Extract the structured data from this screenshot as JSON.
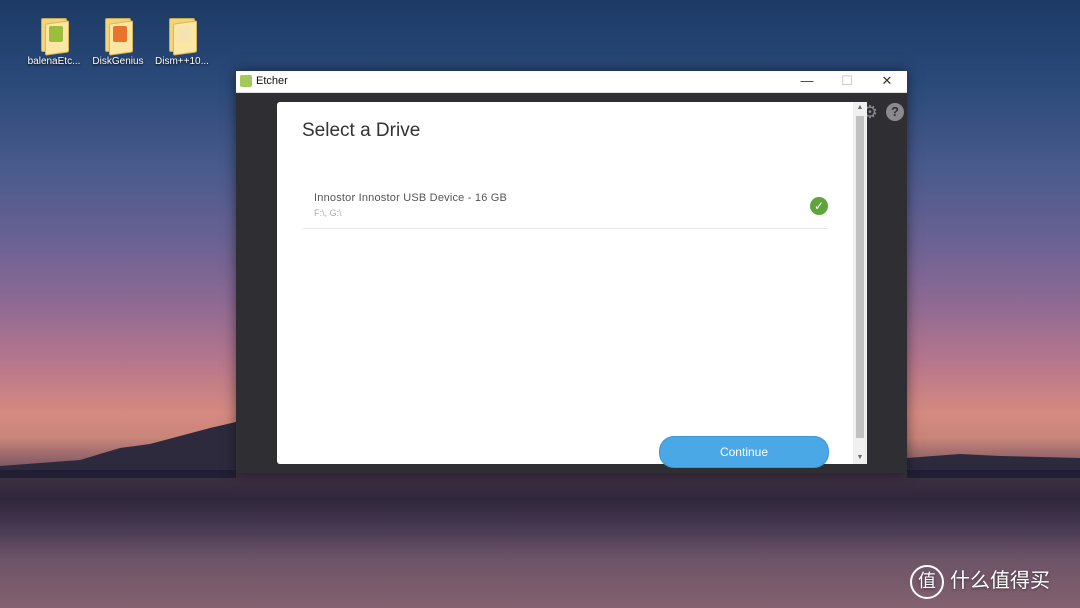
{
  "desktop": {
    "icons": [
      {
        "label": "balenaEtc...",
        "icon": "balena-etcher-folder-icon",
        "badge_color": "#9bbf3a"
      },
      {
        "label": "DiskGenius",
        "icon": "diskgenius-folder-icon",
        "badge_color": "#e8732b"
      },
      {
        "label": "Dism++10...",
        "icon": "dism-folder-icon",
        "badge_color": "#f6e4b0"
      }
    ]
  },
  "window": {
    "title": "Etcher",
    "controls": {
      "minimize": "—",
      "maximize": "☐",
      "close": "✕"
    },
    "toolbar": {
      "settings_icon": "gear-icon",
      "help_icon": "question-icon",
      "help_glyph": "?"
    }
  },
  "modal": {
    "title": "Select a Drive",
    "drives": [
      {
        "name": "Innostor Innostor USB Device - 16 GB",
        "path": "F:\\, G:\\",
        "selected": true
      }
    ],
    "continue_label": "Continue"
  },
  "watermark": {
    "text": "什么值得买",
    "logo_glyph": "值"
  },
  "colors": {
    "accent": "#4aa8e6",
    "check": "#5fa53c",
    "window_bg": "#2f2f33"
  }
}
